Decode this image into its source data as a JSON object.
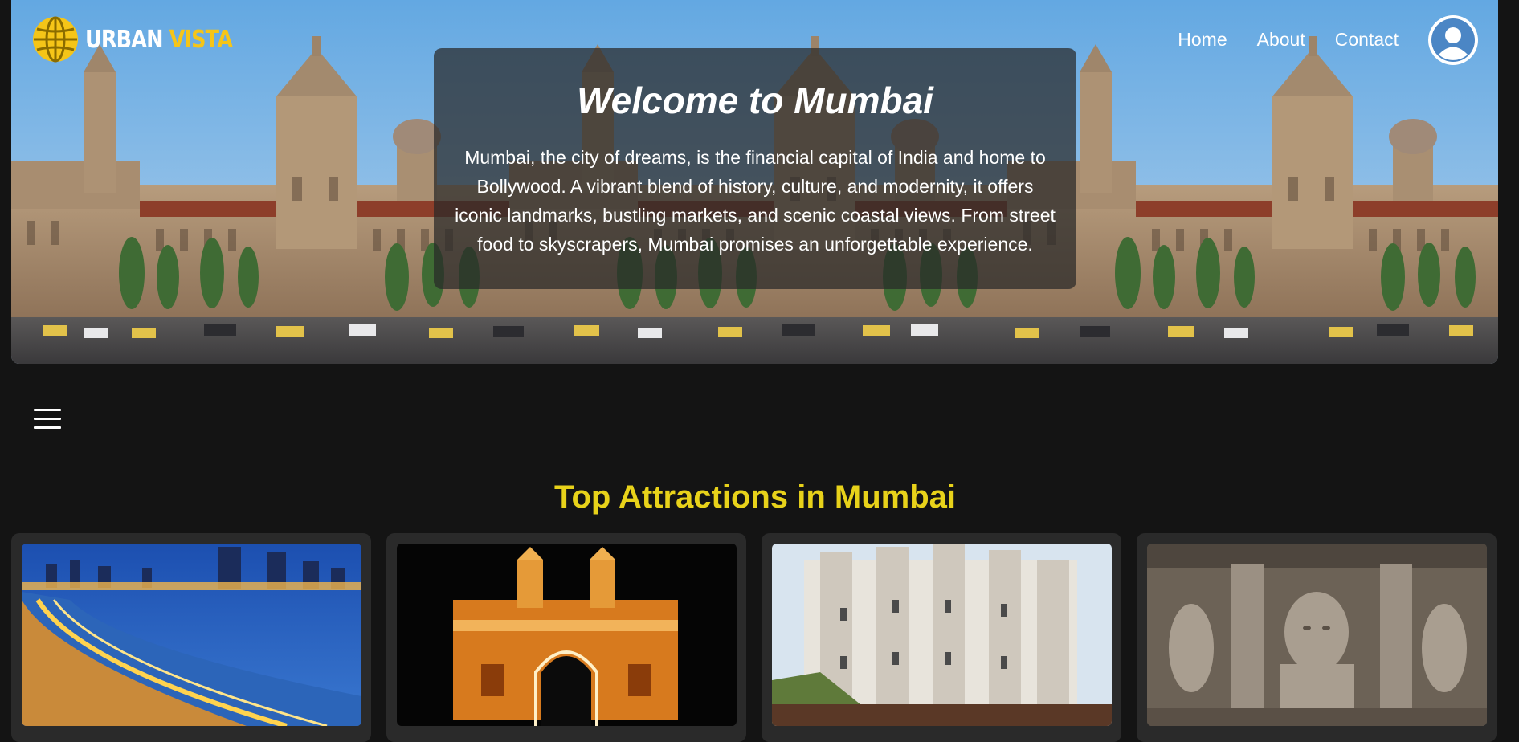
{
  "brand": {
    "name_part1": "URBAN",
    "name_part2": "VISTA"
  },
  "nav": {
    "items": [
      "Home",
      "About",
      "Contact"
    ]
  },
  "hero": {
    "title": "Welcome to Mumbai",
    "description": "Mumbai, the city of dreams, is the financial capital of India and home to Bollywood. A vibrant blend of history, culture, and modernity, it offers iconic landmarks, bustling markets, and scenic coastal views. From street food to skyscrapers, Mumbai promises an unforgettable experience."
  },
  "section": {
    "title": "Top Attractions in Mumbai"
  },
  "attractions": [
    {
      "icon": "marine-drive-photo"
    },
    {
      "icon": "gateway-of-india-photo"
    },
    {
      "icon": "siddhivinayak-temple-photo"
    },
    {
      "icon": "elephanta-caves-photo"
    }
  ],
  "colors": {
    "accent": "#e8d21a",
    "logo_yellow": "#f5c518",
    "background": "#141414",
    "card": "#2a2a2a"
  }
}
